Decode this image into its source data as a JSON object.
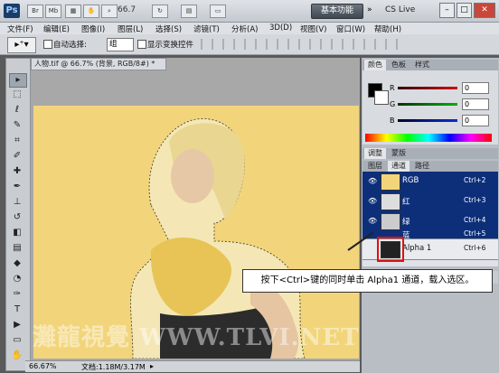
{
  "titlebar": {
    "logo": "Ps",
    "icons": [
      "Br",
      "Mb"
    ],
    "zoom": "66.7",
    "workspace": "基本功能",
    "cslive": "CS Live"
  },
  "menu": [
    "文件(F)",
    "编辑(E)",
    "图像(I)",
    "图层(L)",
    "选择(S)",
    "滤镜(T)",
    "分析(A)",
    "3D(D)",
    "视图(V)",
    "窗口(W)",
    "帮助(H)"
  ],
  "options": {
    "auto_select": "自动选择:",
    "auto_select_value": "组",
    "show_transform": "显示变换控件"
  },
  "document": {
    "tab": "人物.tif @ 66.7% (背景, RGB/8#) *",
    "zoom": "66.67%",
    "doc_size": "文档:1.18M/3.17M"
  },
  "color_panel": {
    "tabs": [
      "颜色",
      "色板",
      "样式"
    ],
    "channels": [
      {
        "label": "R",
        "value": "0",
        "color": "#d00000"
      },
      {
        "label": "G",
        "value": "0",
        "color": "#00a000"
      },
      {
        "label": "B",
        "value": "0",
        "color": "#0030d0"
      }
    ]
  },
  "adjust_tabs": [
    "调整",
    "蒙版"
  ],
  "layer_tabs": [
    "图层",
    "通道",
    "路径"
  ],
  "channels": [
    {
      "name": "RGB",
      "shortcut": "Ctrl+2"
    },
    {
      "name": "红",
      "shortcut": "Ctrl+3"
    },
    {
      "name": "绿",
      "shortcut": "Ctrl+4"
    },
    {
      "name": "蓝",
      "shortcut": "Ctrl+5"
    },
    {
      "name": "Alpha 1",
      "shortcut": "Ctrl+6"
    }
  ],
  "callout": "按下<Ctrl>键的同时单击 Alpha1 通道，载入选区。",
  "watermark": "灘龍視覺 WWW.TLVI.NET"
}
